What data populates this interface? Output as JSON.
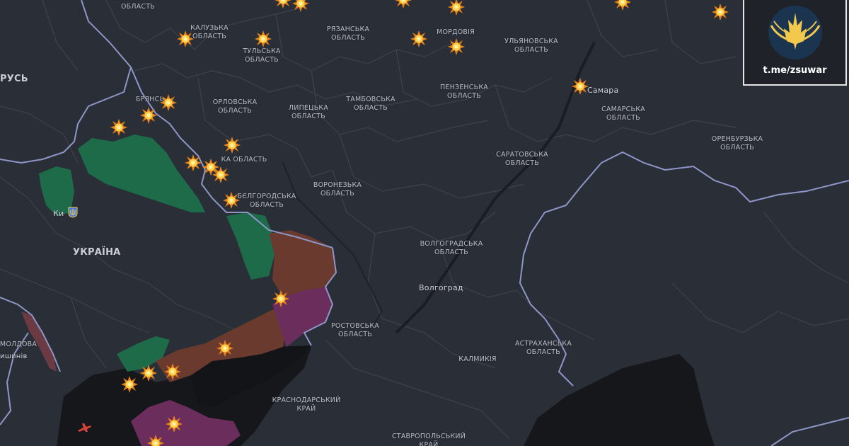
{
  "labels": {
    "smolensk": "СМОЛЕНСЬКА\nОБЛАСТЬ",
    "kaluga": "КАЛУЗЬКА\nОБЛАСТЬ",
    "tula": "ТУЛЬСЬКА\nОБЛАСТЬ",
    "ryazan": "РЯЗАНСЬКА\nОБЛАСТЬ",
    "mordovia": "МОРДОВІЯ",
    "ulyanovsk": "УЛЬЯНОВСЬКА\nОБЛАСТЬ",
    "bryansk": "БРЯНСЬ",
    "oryol": "ОРЛОВСЬКА\nОБЛАСТЬ",
    "lipetsk": "ЛИПЕЦЬКА\nОБЛАСТЬ",
    "tambov": "ТАМБОВСЬКА\nОБЛАСТЬ",
    "penza": "ПЕНЗЕНСЬКА\nОБЛАСТЬ",
    "samara_city": "Самара",
    "samara": "САМАРСЬКА\nОБЛАСТЬ",
    "orenburg": "ОРЕНБУРЗЬКА\nОБЛАСТЬ",
    "kursk": "КА ОБЛАСТЬ",
    "saratov": "САРАТОВСЬКА\nОБЛАСТЬ",
    "voronezh": "ВОРОНЕЗЬКА\nОБЛАСТЬ",
    "belgorod": "БЄЛГОРОДСЬКА\nОБЛАСТЬ",
    "kyiv": "Ки",
    "ukraine": "УКРАЇНА",
    "volgograd_obl": "ВОЛГОГРАДСЬКА\nОБЛАСТЬ",
    "volgograd_city": "Волгоград",
    "rostov": "РОСТОВСЬКА\nОБЛАСТЬ",
    "kalmykia": "КАЛМИКІЯ",
    "astrakhan": "АСТРАХАНСЬКА\nОБЛАСТЬ",
    "krasnodar": "КРАСНОДАРСЬКИЙ\nКРАЙ",
    "stavropol": "СТАВРОПОЛЬСЬКИЙ\nКРАЙ",
    "moldova": "МОЛДОВА",
    "chisinau": "ишинів",
    "belarus": "РУСЬ"
  },
  "branding": {
    "handle": "t.me/zsuwar",
    "logo_icon": "trident-emblem-icon"
  },
  "colors": {
    "background": "#2a2e37",
    "region_border": "#3c414c",
    "state_border": "#8e96c8",
    "liberated": "#1e6b4a",
    "occupied": "#6b3a2e",
    "occupied_2014": "#6b2e5c",
    "sea": "#15171b",
    "strike": "#f5a623"
  },
  "icons": {
    "strike": "explosion-icon",
    "kyiv_marker": "trident-shield-icon",
    "aircraft": "aircraft-icon"
  }
}
